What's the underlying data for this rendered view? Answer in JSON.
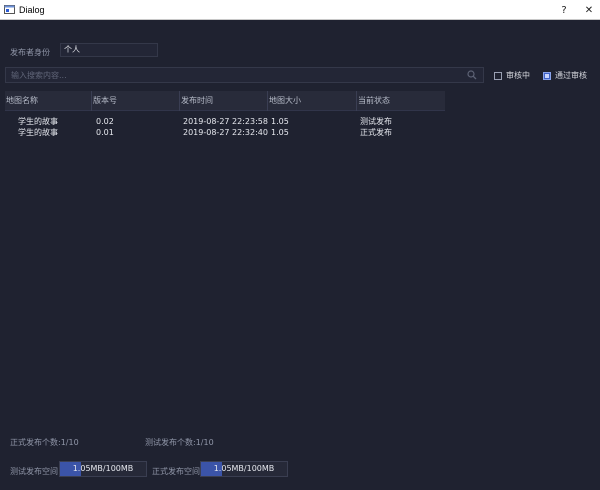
{
  "window": {
    "title": "Dialog",
    "help_glyph": "?",
    "close_glyph": "✕"
  },
  "filter": {
    "identity_label": "发布者身份",
    "identity_value": "个人",
    "search_placeholder": "输入搜索内容...",
    "checkbox_review": {
      "label": "审核中",
      "checked": false
    },
    "checkbox_passed": {
      "label": "通过审核",
      "checked": true
    }
  },
  "table": {
    "columns": [
      "地图名称",
      "版本号",
      "发布时间",
      "地图大小",
      "当前状态"
    ],
    "rows": [
      [
        "学生的故事",
        "0.02",
        "2019-08-27 22:23:58",
        "1.05",
        "测试发布"
      ],
      [
        "学生的故事",
        "0.01",
        "2019-08-27 22:32:40",
        "1.05",
        "正式发布"
      ]
    ]
  },
  "footer": {
    "formal_count": "正式发布个数:1/10",
    "test_count": "测试发布个数:1/10",
    "test_space_label": "测试发布空间",
    "test_space_value": "1.05MB/100MB",
    "test_space_fraction": 0.24,
    "formal_space_label": "正式发布空间",
    "formal_space_value": "1.05MB/100MB",
    "formal_space_fraction": 0.24
  },
  "colors": {
    "background": "#1f2230",
    "accent": "#3b54a8"
  }
}
